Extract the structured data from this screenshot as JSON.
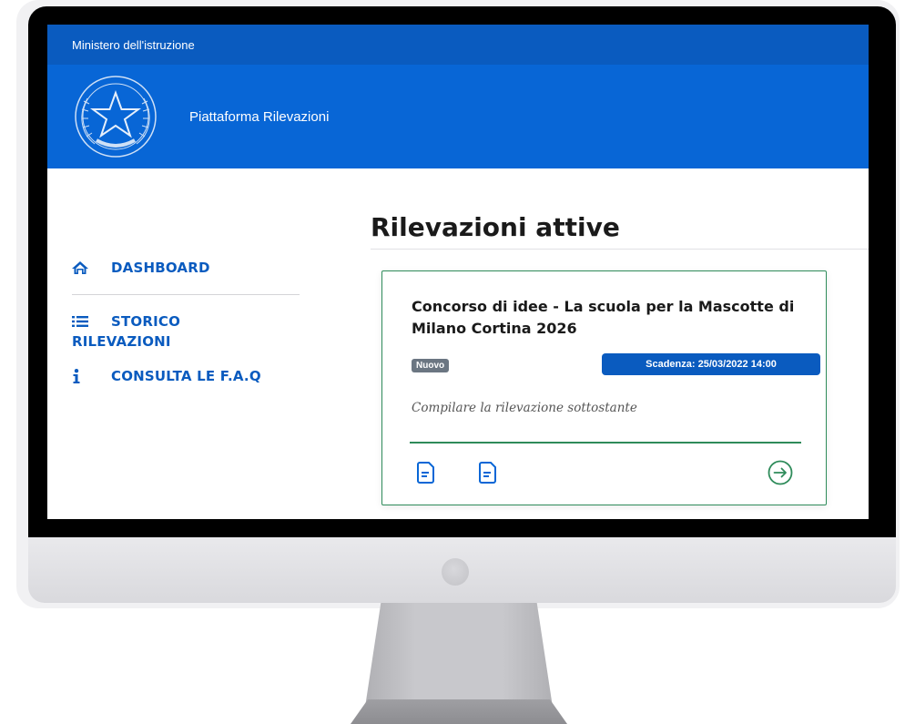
{
  "topbar": {
    "ministry": "Ministero dell'istruzione"
  },
  "header": {
    "platform_title": "Piattaforma Rilevazioni"
  },
  "sidebar": {
    "items": [
      {
        "icon": "home-icon",
        "label": "DASHBOARD"
      },
      {
        "icon": "list-icon",
        "label_line1": "STORICO",
        "label_line2": "RILEVAZIONI"
      },
      {
        "icon": "info-icon",
        "label": "CONSULTA LE F.A.Q"
      }
    ]
  },
  "main": {
    "title": "Rilevazioni attive",
    "card": {
      "title": "Concorso di idee - La scuola per la Mascotte di Milano Cortina 2026",
      "badge": "Nuovo",
      "deadline": "Scadenza: 25/03/2022 14:00",
      "description": "Compilare la rilevazione sottostante",
      "actions": [
        "document-icon",
        "document-icon",
        "arrow-right-circle-icon"
      ]
    }
  },
  "colors": {
    "primary_blue": "#0866d6",
    "topbar_blue": "#0a5bbf",
    "card_green": "#2e8b5a",
    "badge_gray": "#6b7682"
  }
}
